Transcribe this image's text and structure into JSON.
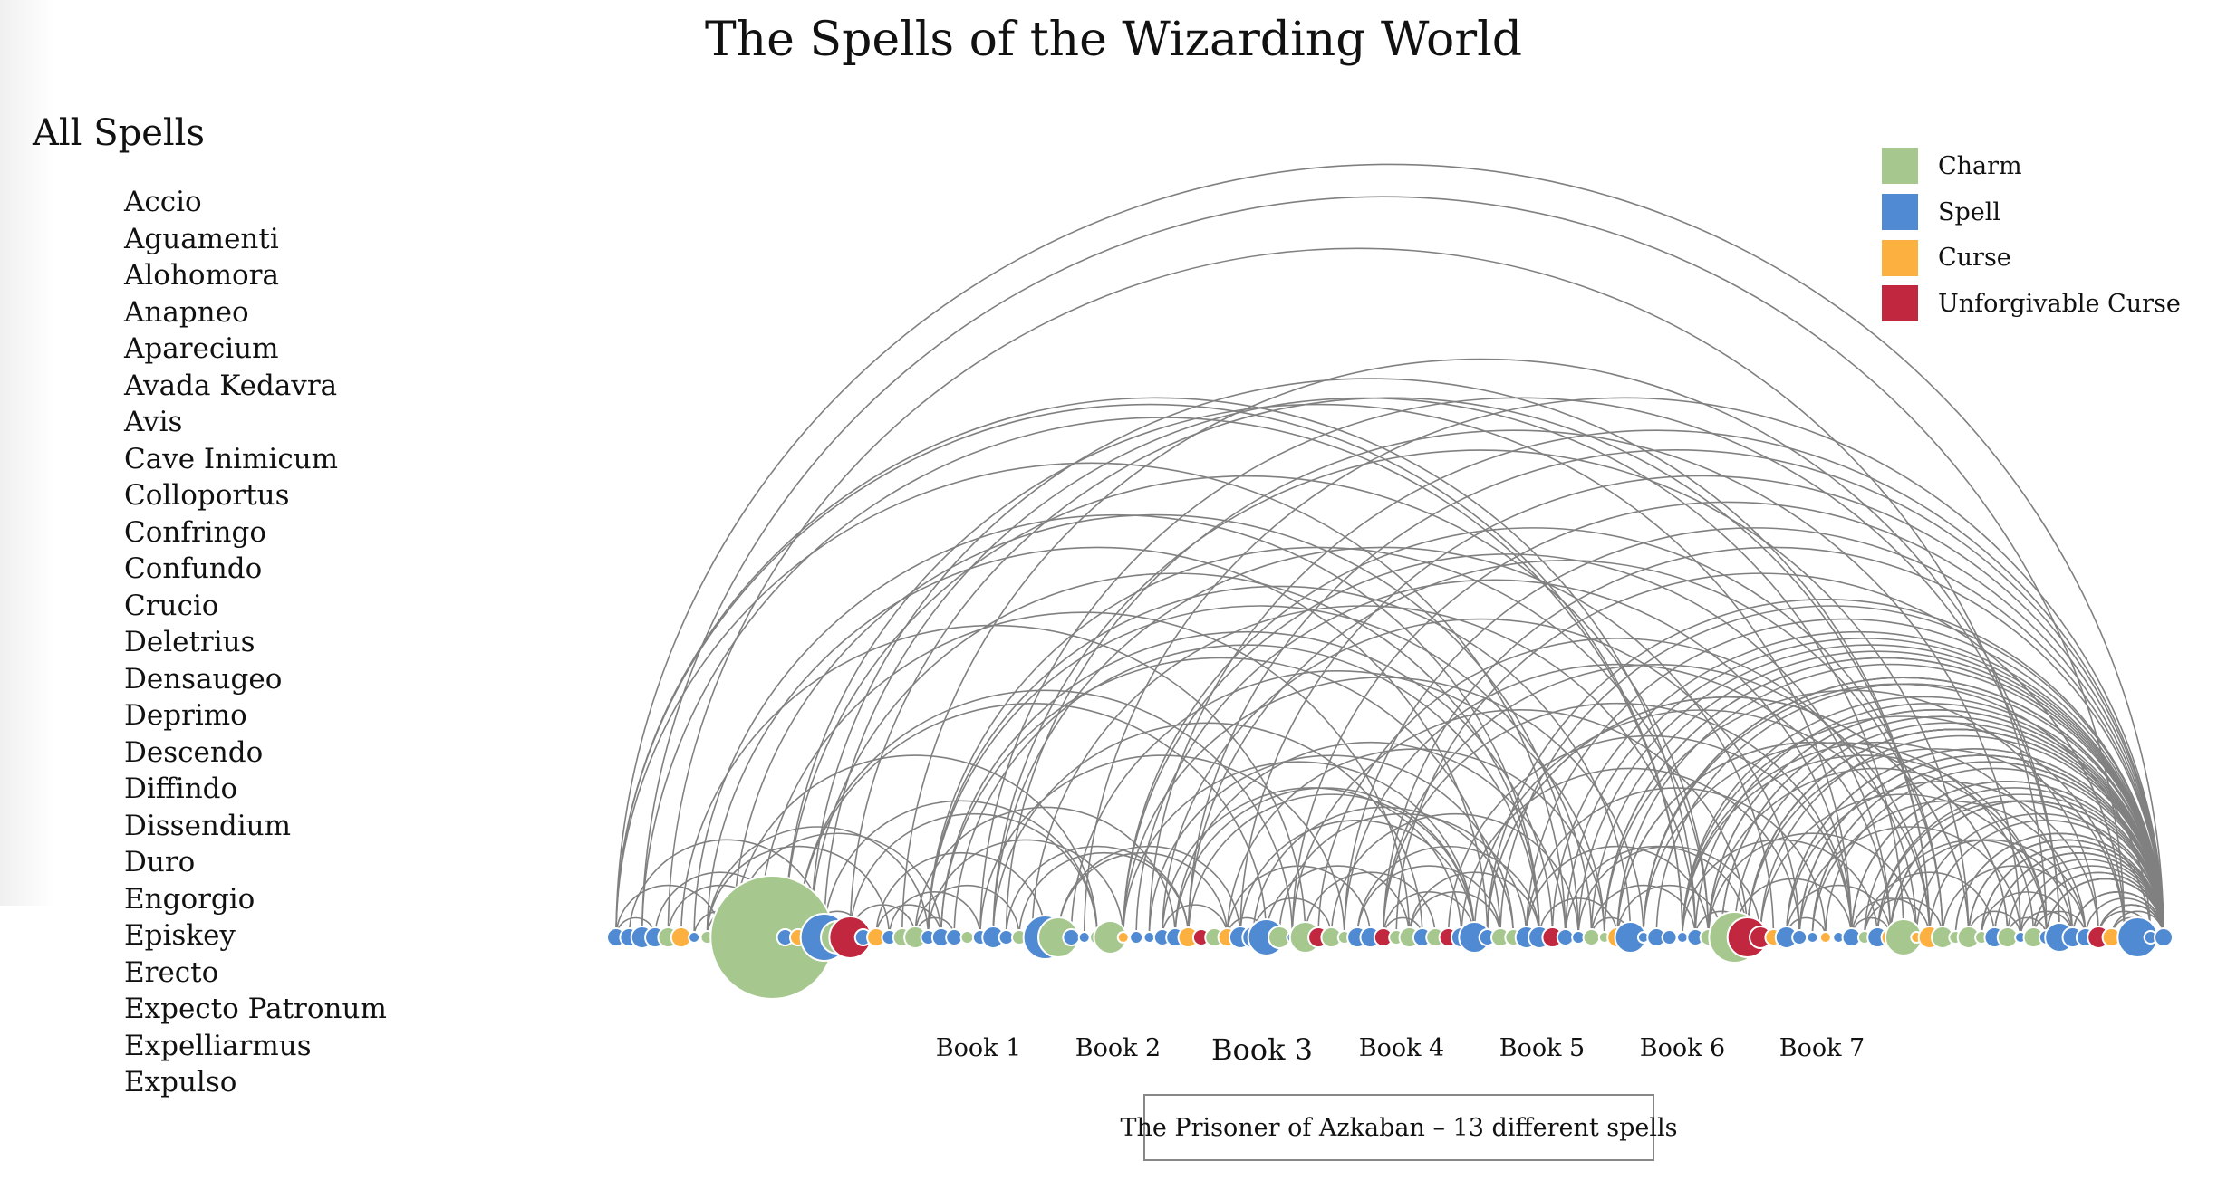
{
  "title": "The Spells of the Wizarding World",
  "spell_list": {
    "heading": "All Spells",
    "items": [
      "Accio",
      "Aguamenti",
      "Alohomora",
      "Anapneo",
      "Aparecium",
      "Avada Kedavra",
      "Avis",
      "Cave Inimicum",
      "Colloportus",
      "Confringo",
      "Confundo",
      "Crucio",
      "Deletrius",
      "Densaugeo",
      "Deprimo",
      "Descendo",
      "Diffindo",
      "Dissendium",
      "Duro",
      "Engorgio",
      "Episkey",
      "Erecto",
      "Expecto Patronum",
      "Expelliarmus",
      "Expulso"
    ]
  },
  "legend": [
    {
      "label": "Charm",
      "color": "#a6c88f"
    },
    {
      "label": "Spell",
      "color": "#4f8ad2"
    },
    {
      "label": "Curse",
      "color": "#fbb040"
    },
    {
      "label": "Unforgivable Curse",
      "color": "#c1273f"
    }
  ],
  "books": [
    {
      "label": "Book 1",
      "active": false
    },
    {
      "label": "Book 2",
      "active": false
    },
    {
      "label": "Book 3",
      "active": true
    },
    {
      "label": "Book 4",
      "active": false
    },
    {
      "label": "Book 5",
      "active": false
    },
    {
      "label": "Book 6",
      "active": false
    },
    {
      "label": "Book 7",
      "active": false
    }
  ],
  "selected_book_info": "The Prisoner of Azkaban – 13 different spells",
  "arc_color": "#808080"
}
